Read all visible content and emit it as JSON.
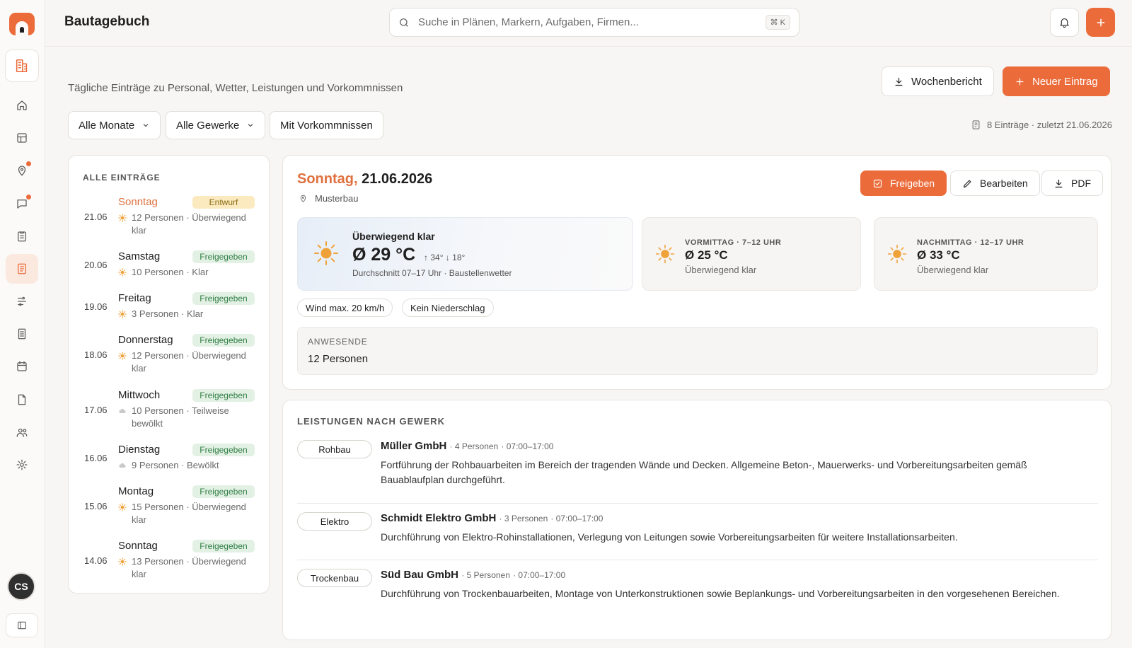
{
  "app": {
    "title": "Bautagebuch",
    "search_placeholder": "Suche in Plänen, Markern, Aufgaben, Firmen...",
    "search_shortcut": "⌘ K",
    "user_initials": "CS",
    "accent_color": "#ec6b3a"
  },
  "rail": {
    "items": [
      {
        "name": "home-icon",
        "active": false,
        "dot": false
      },
      {
        "name": "plans-icon",
        "active": false,
        "dot": false
      },
      {
        "name": "marker-icon",
        "active": false,
        "dot": true
      },
      {
        "name": "chat-icon",
        "active": false,
        "dot": true
      },
      {
        "name": "tasks-icon",
        "active": false,
        "dot": false
      },
      {
        "name": "diary-icon",
        "active": true,
        "dot": false
      },
      {
        "name": "schedule-icon",
        "active": false,
        "dot": false
      },
      {
        "name": "report-icon",
        "active": false,
        "dot": false
      },
      {
        "name": "calendar-icon",
        "active": false,
        "dot": false
      },
      {
        "name": "document-icon",
        "active": false,
        "dot": false
      },
      {
        "name": "team-icon",
        "active": false,
        "dot": false
      },
      {
        "name": "settings-icon",
        "active": false,
        "dot": false
      }
    ]
  },
  "header": {
    "subtitle": "Tägliche Einträge zu Personal, Wetter, Leistungen und Vorkommnissen",
    "weekly_report_label": "Wochenbericht",
    "new_entry_label": "Neuer Eintrag",
    "filters": [
      "Alle Monate",
      "Alle Gewerke",
      "Mit Vorkommnissen"
    ],
    "entry_count": "8 Einträge · zuletzt 21.06.2026"
  },
  "entries": {
    "title": "ALLE EINTRÄGE",
    "items": [
      {
        "date": "21.06",
        "day": "Sonntag",
        "status": "Entwurf",
        "meta": "12 Personen · Überwiegend klar",
        "weather": "sun",
        "current": true
      },
      {
        "date": "20.06",
        "day": "Samstag",
        "status": "Freigegeben",
        "meta": "10 Personen · Klar",
        "weather": "sun",
        "current": false
      },
      {
        "date": "19.06",
        "day": "Freitag",
        "status": "Freigegeben",
        "meta": "3 Personen · Klar",
        "weather": "sun",
        "current": false
      },
      {
        "date": "18.06",
        "day": "Donnerstag",
        "status": "Freigegeben",
        "meta": "12 Personen · Überwiegend klar",
        "weather": "sun",
        "current": false
      },
      {
        "date": "17.06",
        "day": "Mittwoch",
        "status": "Freigegeben",
        "meta": "10 Personen · Teilweise bewölkt",
        "weather": "cloud",
        "current": false
      },
      {
        "date": "16.06",
        "day": "Dienstag",
        "status": "Freigegeben",
        "meta": "9 Personen · Bewölkt",
        "weather": "cloud",
        "current": false
      },
      {
        "date": "15.06",
        "day": "Montag",
        "status": "Freigegeben",
        "meta": "15 Personen · Überwiegend klar",
        "weather": "sun",
        "current": false
      },
      {
        "date": "14.06",
        "day": "Sonntag",
        "status": "Freigegeben",
        "meta": "13 Personen · Überwiegend klar",
        "weather": "sun",
        "current": false
      }
    ]
  },
  "detail": {
    "day": "Sonntag,",
    "date": "21.06.2026",
    "location": "Musterbau",
    "approve_label": "Freigeben",
    "edit_label": "Bearbeiten",
    "pdf_label": "PDF",
    "weather": {
      "label": "Überwiegend klar",
      "temp": "Ø 29 °C",
      "high": "34°",
      "low": "18°",
      "desc": "Durchschnitt 07–17 Uhr · Baustellenwetter"
    },
    "morning": {
      "label": "VORMITTAG · 7–12 UHR",
      "temp": "Ø 25 °C",
      "desc": "Überwiegend klar"
    },
    "afternoon": {
      "label": "NACHMITTAG · 12–17 UHR",
      "temp": "Ø 33 °C",
      "desc": "Überwiegend klar"
    },
    "wind": "Wind max. 20 km/h",
    "precipitation": "Kein Niederschlag",
    "present_label": "ANWESENDE",
    "present_value": "12 Personen"
  },
  "services": {
    "title": "LEISTUNGEN NACH GEWERK",
    "items": [
      {
        "trade": "Rohbau",
        "company": "Müller GmbH",
        "persons": "· 4 Personen",
        "time": "· 07:00–17:00",
        "text": "Fortführung der Rohbauarbeiten im Bereich der tragenden Wände und Decken. Allgemeine Beton-, Mauerwerks- und Vorbereitungsarbeiten gemäß Bauablaufplan durchgeführt."
      },
      {
        "trade": "Elektro",
        "company": "Schmidt Elektro GmbH",
        "persons": "· 3 Personen",
        "time": "· 07:00–17:00",
        "text": "Durchführung von Elektro-Rohinstallationen, Verlegung von Leitungen sowie Vorbereitungsarbeiten für weitere Installationsarbeiten."
      },
      {
        "trade": "Trockenbau",
        "company": "Süd Bau GmbH",
        "persons": "· 5 Personen",
        "time": "· 07:00–17:00",
        "text": "Durchführung von Trockenbauarbeiten, Montage von Unterkonstruktionen sowie Beplankungs- und Vorbereitungsarbeiten in den vorgesehenen Bereichen."
      }
    ]
  }
}
